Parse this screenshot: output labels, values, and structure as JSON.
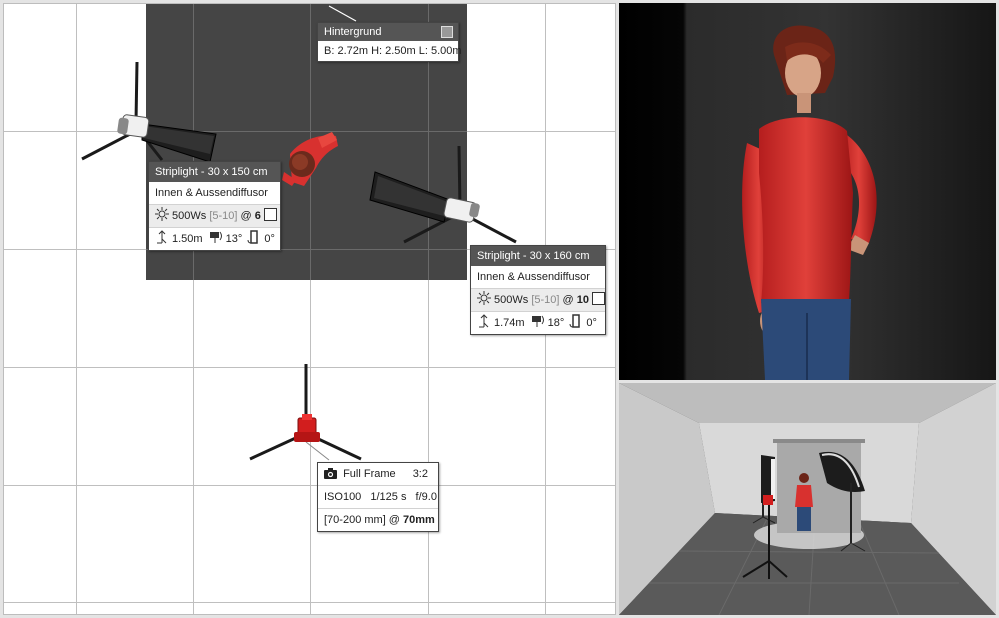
{
  "background_box": {
    "title": "Hintergrund",
    "dimensions": "B: 2.72m H: 2.50m L: 5.00m"
  },
  "light_left": {
    "title": "Striplight - 30 x 150 cm",
    "use": "Innen & Aussendiffusor",
    "power": "500Ws",
    "range": "[5-10]",
    "at": "@",
    "setting": "6",
    "height": "1.50m",
    "tilt": "13°",
    "rotation": "0°"
  },
  "light_right": {
    "title": "Striplight - 30 x 160 cm",
    "use": "Innen & Aussendiffusor",
    "power": "500Ws",
    "range": "[5-10]",
    "at": "@",
    "setting": "10",
    "height": "1.74m",
    "tilt": "18°",
    "rotation": "0°"
  },
  "camera_box": {
    "sensor": "Full Frame",
    "ratio": "3:2",
    "iso": "ISO100",
    "shutter": "1/125 s",
    "aperture": "f/9.0",
    "lens": "[70-200 mm] @",
    "focal": "70mm"
  },
  "colors": {
    "backdrop": "#454545",
    "header": "#555555",
    "model_shirt": "#d8312f",
    "model_jeans": "#2c4a78",
    "grid": "#bfbfbf"
  },
  "icons": [
    "camera-icon",
    "flash-power-icon",
    "height-icon",
    "tilt-icon",
    "rotation-icon"
  ]
}
